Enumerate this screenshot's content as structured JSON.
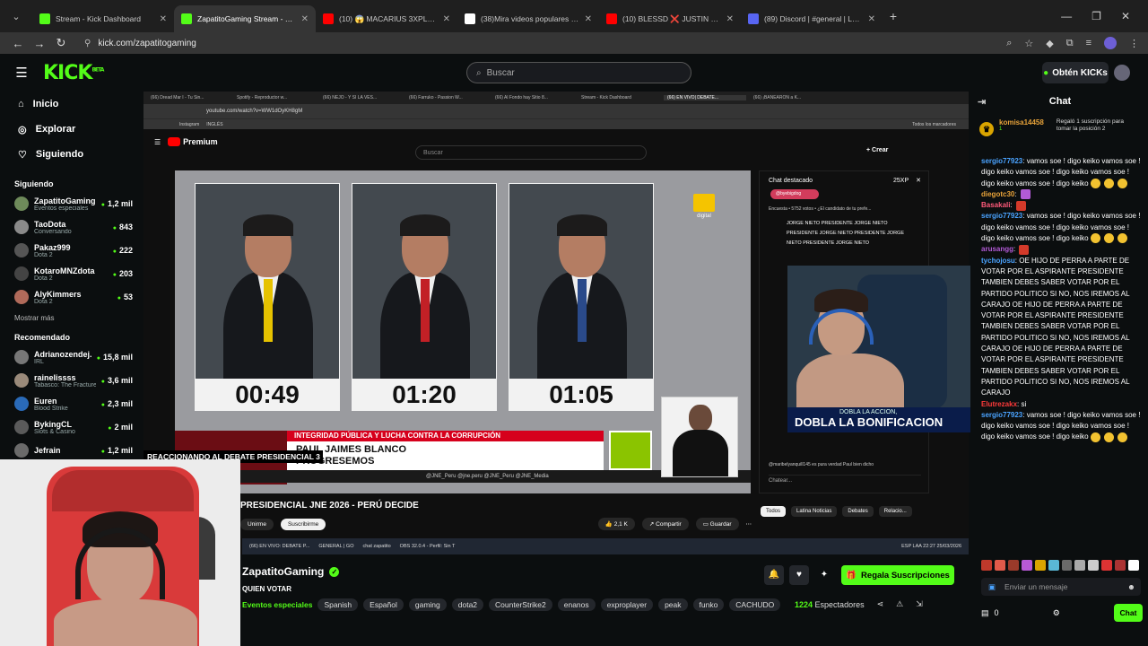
{
  "browser": {
    "tabs": [
      {
        "title": "Stream - Kick Dashboard",
        "color": "#53fc18",
        "active": false
      },
      {
        "title": "ZapatitoGaming Stream - Kick",
        "color": "#53fc18",
        "active": true
      },
      {
        "title": "(10) 😱 MACARIUS 3XPLOTO y...",
        "color": "#ff0000",
        "active": false
      },
      {
        "title": "(38)Mira videos populares selec...",
        "color": "#ffffff",
        "active": false
      },
      {
        "title": "(10) BLESSD ❌ JUSTIN QUILES...",
        "color": "#ff0000",
        "active": false
      },
      {
        "title": "(89) Discord | #general | Lo...",
        "color": "#5865f2",
        "active": false
      }
    ],
    "url": "kick.com/zapatitogaming"
  },
  "kick": {
    "search_placeholder": "Buscar",
    "get_kicks": "Obtén KICKs",
    "nav": [
      {
        "icon": "home-icon",
        "glyph": "⌂",
        "label": "Inicio"
      },
      {
        "icon": "compass-icon",
        "glyph": "◎",
        "label": "Explorar"
      },
      {
        "icon": "heart-icon",
        "glyph": "♡",
        "label": "Siguiendo"
      }
    ],
    "following_title": "Siguiendo",
    "following": [
      {
        "name": "ZapatitoGaming",
        "category": "Eventos especiales",
        "viewers": "1,2 mil",
        "color": "#6e8a5a"
      },
      {
        "name": "TaoDota",
        "category": "Conversando",
        "viewers": "843",
        "color": "#8a8a8a"
      },
      {
        "name": "Pakaz999",
        "category": "Dota 2",
        "viewers": "222",
        "color": "#555"
      },
      {
        "name": "KotaroMNZdota",
        "category": "Dota 2",
        "viewers": "203",
        "color": "#444"
      },
      {
        "name": "AlyKimmers",
        "category": "Dota 2",
        "viewers": "53",
        "color": "#b06a5a"
      }
    ],
    "show_more": "Mostrar más",
    "recommended_title": "Recomendado",
    "recommended": [
      {
        "name": "Adrianozendej...",
        "category": "IRL",
        "viewers": "15,8 mil",
        "color": "#777"
      },
      {
        "name": "rainelissss",
        "category": "Tabasco: The Fracture",
        "viewers": "3,6 mil",
        "color": "#9a8a7a"
      },
      {
        "name": "Euren",
        "category": "Blood Strike",
        "viewers": "2,3 mil",
        "color": "#2a6ab8"
      },
      {
        "name": "BykingCL",
        "category": "Slots & Casino",
        "viewers": "2 mil",
        "color": "#5a5a5a"
      },
      {
        "name": "Jefrain",
        "category": "",
        "viewers": "1,2 mil",
        "color": "#6a6a6a"
      }
    ]
  },
  "youtube": {
    "tabs": [
      "(66) Dread Mar I - Tu Sin...",
      "Spotify - Reproductor w...",
      "(66) ÑEJO - Y SI LA VES...",
      "(66) Farruko - Passion W...",
      "(66) Al Fondo hay Sitio 8...",
      "Stream - Kick Dashboard",
      "(66) EN VIVO| DEBATE...",
      "(66) ¡BANEARON a K..."
    ],
    "url": "youtube.com/watch?v=WW1dOyKH8gM",
    "bookmarks": [
      "Instagram",
      "INGLÉS"
    ],
    "all_bookmarks": "Todos los marcadores",
    "premium": "Premium",
    "search": "Buscar",
    "create": "+ Crear",
    "timers": [
      "00:49",
      "01:20",
      "01:05"
    ],
    "tie_colors": [
      "#e6c200",
      "#c22026",
      "#2a4a8a"
    ],
    "channel_logo_text": "digital",
    "lower_red": "INTEGRIDAD PÚBLICA Y LUCHA CONTRA LA CORRUPCIÓN",
    "lower_name_1": "PAUL JAIMES BLANCO",
    "lower_name_2": "PROGRESEMOS",
    "lower_bar": "@JNE_Peru   @jne.peru   @JNE_Peru   @JNE_Media",
    "video_title": "PRESIDENCIAL JNE 2026 - PERÚ DECIDE",
    "join": "Unirme",
    "subscribe": "Suscribirme",
    "likes": "2,1 K",
    "share": "Compartir",
    "save": "Guardar",
    "chips": [
      "Todos",
      "Latina Noticias",
      "Debates",
      "Relacio..."
    ],
    "taskbar": [
      "(66) EN VIVO: DEBATE P...",
      "GENERAL | GO",
      "chat zapatito",
      "OBS 32.0.4 - Perfil: Sin T"
    ],
    "tray": "ESP LAA  22:27 25/03/2026",
    "chat": {
      "title": "Chat destacado",
      "points": "25XP",
      "tag": "@byebigdog",
      "poll": "Encuesta • 5752 votos • ¿El candidato de tu prefe...",
      "spam": "JORGE NIETO PRESIDENTE JORGE NIETO PRESIDENTE JORGE NIETO PRESIDENTE JORGE NIETO PRESIDENTE JORGE NIETO",
      "last": "@maribelyanquill145  es pura verdad Paul bien dicho",
      "input": "Chatear..."
    },
    "react_banner": "REACCIONANDO AL DEBATE PRESIDENCIAL 3"
  },
  "facecam": {
    "banner_small": "DOBLA LA ACCION,",
    "banner_big": "DOBLA LA BONIFICACION"
  },
  "kick_chat": {
    "title": "Chat",
    "pinned_user": "komisa14458",
    "pinned_count": "1",
    "pinned_text": "Regaló 1 suscripción para tomar la posición 2",
    "messages": [
      {
        "user": "sergio77923",
        "color": "#4aa3ff",
        "text": "vamos soe ! digo keiko",
        "emos": 12,
        "extra": " vamos soe ! digo keiko vamos soe ! digo keiko vamos soe ! digo keiko vamos soe ! digo keiko"
      },
      {
        "user": "diegotc30",
        "color": "#e8a33a",
        "text": "",
        "emos": 0,
        "extra": ""
      },
      {
        "user": "Basakali",
        "color": "#ff5a7a",
        "text": "",
        "emos": 0,
        "extra": ""
      },
      {
        "user": "sergio77923",
        "color": "#4aa3ff",
        "text": "vamos soe ! digo keiko",
        "emos": 0,
        "extra": " vamos soe ! digo keiko vamos soe ! digo keiko vamos soe ! digo keiko vamos soe ! digo keiko"
      },
      {
        "user": "arusangg",
        "color": "#b25ad6",
        "text": "",
        "emos": 0,
        "extra": ""
      },
      {
        "user": "tychojosu",
        "color": "#4aa3ff",
        "text": "OE HIJO DE PERRA A PARTE DE VOTAR POR EL ASPIRANTE PRESIDENTE TAMBIEN DEBES SABER VOTAR POR EL PARTIDO POLITICO SI NO, NOS IREMOS AL CARAJO OE HIJO DE PERRA A PARTE DE VOTAR POR EL ASPIRANTE PRESIDENTE TAMBIEN DEBES SABER VOTAR POR EL PARTIDO POLITICO SI NO, NOS IREMOS AL CARAJO OE HIJO DE PERRA A PARTE DE VOTAR POR EL ASPIRANTE PRESIDENTE TAMBIEN DEBES SABER VOTAR POR EL PARTIDO POLITICO SI NO, NOS IREMOS AL CARAJO",
        "emos": 0,
        "extra": ""
      },
      {
        "user": "Elutrezakx",
        "color": "#ff3a3a",
        "text": "si",
        "emos": 0,
        "extra": ""
      },
      {
        "user": "sergio77923",
        "color": "#4aa3ff",
        "text": "vamos soe ! digo keiko",
        "emos": 0,
        "extra": " vamos soe ! digo keiko vamos soe ! digo keiko vamos soe ! digo keiko vamos soe ! digo keiko"
      }
    ],
    "input_placeholder": "Enviar un mensaje",
    "kicks_count": "0",
    "chat_button": "Chat"
  },
  "stream_info": {
    "name": "ZapatitoGaming",
    "title": "QUIEN VOTAR",
    "category": "Eventos especiales",
    "tags": [
      "Spanish",
      "Español",
      "gaming",
      "dota2",
      "CounterStrike2",
      "enanos",
      "exproplayer",
      "peak",
      "funko",
      "CACHUDO"
    ],
    "gift_subs": "Regala Suscripciones",
    "viewers": "1224",
    "viewers_label": "Espectadores"
  }
}
